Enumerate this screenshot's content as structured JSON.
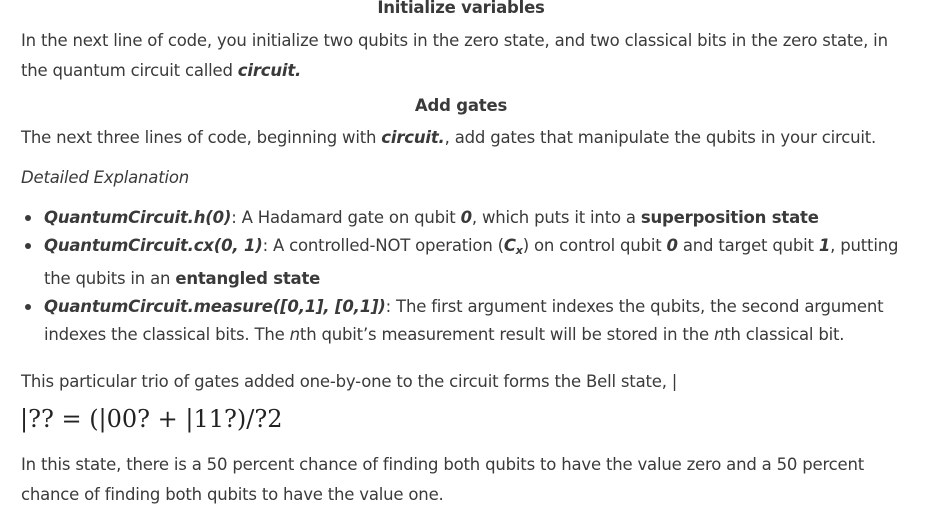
{
  "sections": {
    "init_heading": "Initialize variables",
    "init_paragraph_before": "In the next line of code, you initialize two qubits in the zero state, and two classical bits in the zero state, in the quantum circuit called ",
    "init_paragraph_emph": "circuit.",
    "gates_heading": "Add gates",
    "gates_paragraph_before": "The next three lines of code, beginning with ",
    "gates_paragraph_emph": "circuit.",
    "gates_paragraph_after": ", add gates that manipulate the qubits in your circuit.",
    "detailed_label": "Detailed Explanation"
  },
  "bullets": {
    "h": {
      "code": "QuantumCircuit.h(0)",
      "text_a": ": A Hadamard gate on qubit ",
      "qubit": "0",
      "text_b": ", which puts it into a ",
      "strong": "superposition state"
    },
    "cx": {
      "code": "QuantumCircuit.cx(0, 1)",
      "text_a": ": A controlled-NOT operation (",
      "op_main": "C",
      "op_sub": "x",
      "text_b": ") on control qubit ",
      "control": "0",
      "text_c": " and target qubit ",
      "target": "1",
      "text_d": ", putting the qubits in an ",
      "strong": "entangled state"
    },
    "measure": {
      "code": "QuantumCircuit.measure([0,1], [0,1])",
      "text_a": ": The first argument indexes the qubits, the second argument indexes the classical bits. The ",
      "n1": "n",
      "text_b": "th qubit’s measurement result will be stored in the ",
      "n2": "n",
      "text_c": "th classical bit."
    }
  },
  "bell": {
    "paragraph": "This particular trio of gates added one-by-one to the circuit forms the Bell state, |",
    "formula": "|?? = (|00? + |11?)/?2"
  },
  "closing": {
    "paragraph": "In this state, there is a 50 percent chance of finding both qubits to have the value zero and a 50 percent chance of finding both qubits to have the value one."
  }
}
